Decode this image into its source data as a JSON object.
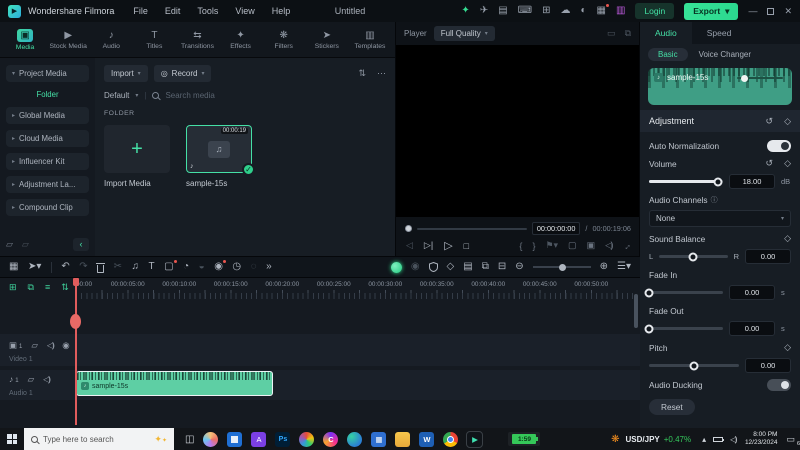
{
  "titlebar": {
    "app_name": "Wondershare Filmora",
    "menus": [
      "File",
      "Edit",
      "Tools",
      "View",
      "Help"
    ],
    "project_title": "Untitled",
    "login_label": "Login",
    "export_label": "Export"
  },
  "media_tabs": [
    {
      "label": "Media",
      "glyph": "▣",
      "active": true
    },
    {
      "label": "Stock Media",
      "glyph": "▶"
    },
    {
      "label": "Audio",
      "glyph": "♪"
    },
    {
      "label": "Titles",
      "glyph": "T"
    },
    {
      "label": "Transitions",
      "glyph": "⇆"
    },
    {
      "label": "Effects",
      "glyph": "✦"
    },
    {
      "label": "Filters",
      "glyph": "❋"
    },
    {
      "label": "Stickers",
      "glyph": "➤"
    },
    {
      "label": "Templates",
      "glyph": "▥"
    }
  ],
  "sidebar": {
    "project_media": "Project Media",
    "folder": "Folder",
    "items": [
      "Global Media",
      "Cloud Media",
      "Influencer Kit",
      "Adjustment La...",
      "Compound Clip"
    ]
  },
  "media_panel": {
    "import_label": "Import",
    "record_label": "Record",
    "sort_label": "Default",
    "search_placeholder": "Search media",
    "section_label": "FOLDER",
    "import_card_label": "Import Media",
    "clip_name": "sample-15s",
    "clip_duration": "00:00:19"
  },
  "player": {
    "label": "Player",
    "quality": "Full Quality",
    "current_time": "00:00:00:00",
    "separator": "/",
    "total_time": "00:00:19:06"
  },
  "audio_panel": {
    "tab_audio": "Audio",
    "tab_speed": "Speed",
    "subtab_basic": "Basic",
    "subtab_voice": "Voice Changer",
    "clip_name": "sample-15s",
    "section_title": "Adjustment",
    "auto_normalization_label": "Auto Normalization",
    "volume": {
      "label": "Volume",
      "value": "18.00",
      "unit": "dB",
      "percent": 93
    },
    "audio_channels": {
      "label": "Audio Channels",
      "value": "None"
    },
    "sound_balance": {
      "label": "Sound Balance",
      "left": "L",
      "right": "R",
      "value": "0.00",
      "percent": 50
    },
    "fade_in": {
      "label": "Fade In",
      "value": "0.00",
      "unit": "s",
      "percent": 0
    },
    "fade_out": {
      "label": "Fade Out",
      "value": "0.00",
      "unit": "s",
      "percent": 0
    },
    "pitch": {
      "label": "Pitch",
      "value": "0.00",
      "percent": 50
    },
    "audio_ducking_label": "Audio Ducking",
    "reset_label": "Reset"
  },
  "timeline": {
    "ruler_labels": [
      "00:00",
      "00:00:05:00",
      "00:00:10:00",
      "00:00:15:00",
      "00:00:20:00",
      "00:00:25:00",
      "00:00:30:00",
      "00:00:35:00",
      "00:00:40:00",
      "00:00:45:00",
      "00:00:50:00"
    ],
    "video_track": "Video 1",
    "video_num": "1",
    "audio_track": "Audio 1",
    "audio_num": "1",
    "clip_name": "sample-15s"
  },
  "taskbar": {
    "search_placeholder": "Type here to search",
    "a_label": "A",
    "ps_label": "Ps",
    "word_label": "W",
    "clipchamp_label": "C",
    "battery_time": "1:59",
    "ticker_symbol": "USD/JPY",
    "ticker_change": "+0.47%",
    "clock_time": "8:00 PM",
    "clock_date": "12/23/2024",
    "notification_count": "6"
  },
  "colors": {
    "accent": "#45e0a6",
    "export_green": "#2fe08e",
    "clip_green": "#5ecfa4",
    "playhead_red": "#e05c5c",
    "ticker_up": "#35c95c"
  }
}
